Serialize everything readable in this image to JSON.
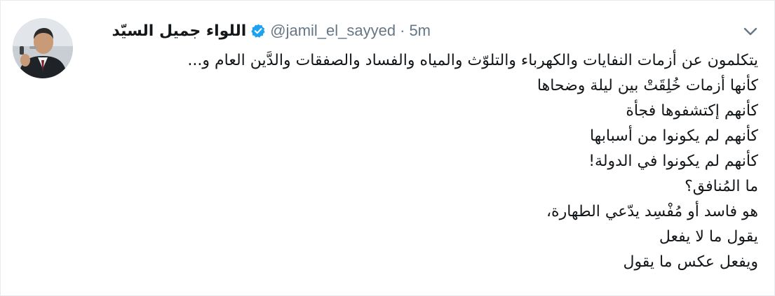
{
  "tweet": {
    "display_name": "اللواء جميل السيّد",
    "handle": "@jamil_el_sayyed",
    "separator": "·",
    "time_ago": "5m",
    "verified": true,
    "lines": [
      "يتكلمون عن أزمات النفايات والكهرباء والتلوّث والمياه والفساد والصفقات والدَّين العام و...",
      "كأنها أزمات خُلِقَتْ بين ليلة وضحاها",
      "كأنهم إكتشفوها فجأة",
      "كأنهم لم يكونوا من أسبابها",
      "كأنهم لم يكونوا في الدولة!",
      "ما المُنافق؟",
      "هو فاسد أو مُفْسِد يدّعي الطهارة،",
      "يقول ما لا يفعل",
      "ويفعل عكس ما يقول"
    ]
  },
  "icons": {
    "verified": "verified-badge-icon",
    "menu": "chevron-down-icon"
  },
  "colors": {
    "accent": "#1da1f2",
    "text": "#14171a",
    "secondary": "#657786",
    "border": "#e6ecf0"
  }
}
